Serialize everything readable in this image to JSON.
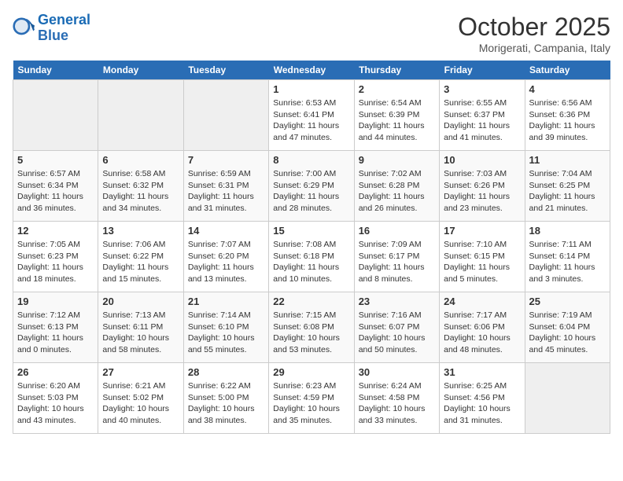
{
  "logo": {
    "line1": "General",
    "line2": "Blue"
  },
  "title": "October 2025",
  "location": "Morigerati, Campania, Italy",
  "weekdays": [
    "Sunday",
    "Monday",
    "Tuesday",
    "Wednesday",
    "Thursday",
    "Friday",
    "Saturday"
  ],
  "weeks": [
    [
      {
        "day": "",
        "empty": true
      },
      {
        "day": "",
        "empty": true
      },
      {
        "day": "",
        "empty": true
      },
      {
        "day": "1",
        "sunrise": "6:53 AM",
        "sunset": "6:41 PM",
        "daylight": "11 hours and 47 minutes."
      },
      {
        "day": "2",
        "sunrise": "6:54 AM",
        "sunset": "6:39 PM",
        "daylight": "11 hours and 44 minutes."
      },
      {
        "day": "3",
        "sunrise": "6:55 AM",
        "sunset": "6:37 PM",
        "daylight": "11 hours and 41 minutes."
      },
      {
        "day": "4",
        "sunrise": "6:56 AM",
        "sunset": "6:36 PM",
        "daylight": "11 hours and 39 minutes."
      }
    ],
    [
      {
        "day": "5",
        "sunrise": "6:57 AM",
        "sunset": "6:34 PM",
        "daylight": "11 hours and 36 minutes."
      },
      {
        "day": "6",
        "sunrise": "6:58 AM",
        "sunset": "6:32 PM",
        "daylight": "11 hours and 34 minutes."
      },
      {
        "day": "7",
        "sunrise": "6:59 AM",
        "sunset": "6:31 PM",
        "daylight": "11 hours and 31 minutes."
      },
      {
        "day": "8",
        "sunrise": "7:00 AM",
        "sunset": "6:29 PM",
        "daylight": "11 hours and 28 minutes."
      },
      {
        "day": "9",
        "sunrise": "7:02 AM",
        "sunset": "6:28 PM",
        "daylight": "11 hours and 26 minutes."
      },
      {
        "day": "10",
        "sunrise": "7:03 AM",
        "sunset": "6:26 PM",
        "daylight": "11 hours and 23 minutes."
      },
      {
        "day": "11",
        "sunrise": "7:04 AM",
        "sunset": "6:25 PM",
        "daylight": "11 hours and 21 minutes."
      }
    ],
    [
      {
        "day": "12",
        "sunrise": "7:05 AM",
        "sunset": "6:23 PM",
        "daylight": "11 hours and 18 minutes."
      },
      {
        "day": "13",
        "sunrise": "7:06 AM",
        "sunset": "6:22 PM",
        "daylight": "11 hours and 15 minutes."
      },
      {
        "day": "14",
        "sunrise": "7:07 AM",
        "sunset": "6:20 PM",
        "daylight": "11 hours and 13 minutes."
      },
      {
        "day": "15",
        "sunrise": "7:08 AM",
        "sunset": "6:18 PM",
        "daylight": "11 hours and 10 minutes."
      },
      {
        "day": "16",
        "sunrise": "7:09 AM",
        "sunset": "6:17 PM",
        "daylight": "11 hours and 8 minutes."
      },
      {
        "day": "17",
        "sunrise": "7:10 AM",
        "sunset": "6:15 PM",
        "daylight": "11 hours and 5 minutes."
      },
      {
        "day": "18",
        "sunrise": "7:11 AM",
        "sunset": "6:14 PM",
        "daylight": "11 hours and 3 minutes."
      }
    ],
    [
      {
        "day": "19",
        "sunrise": "7:12 AM",
        "sunset": "6:13 PM",
        "daylight": "11 hours and 0 minutes."
      },
      {
        "day": "20",
        "sunrise": "7:13 AM",
        "sunset": "6:11 PM",
        "daylight": "10 hours and 58 minutes."
      },
      {
        "day": "21",
        "sunrise": "7:14 AM",
        "sunset": "6:10 PM",
        "daylight": "10 hours and 55 minutes."
      },
      {
        "day": "22",
        "sunrise": "7:15 AM",
        "sunset": "6:08 PM",
        "daylight": "10 hours and 53 minutes."
      },
      {
        "day": "23",
        "sunrise": "7:16 AM",
        "sunset": "6:07 PM",
        "daylight": "10 hours and 50 minutes."
      },
      {
        "day": "24",
        "sunrise": "7:17 AM",
        "sunset": "6:06 PM",
        "daylight": "10 hours and 48 minutes."
      },
      {
        "day": "25",
        "sunrise": "7:19 AM",
        "sunset": "6:04 PM",
        "daylight": "10 hours and 45 minutes."
      }
    ],
    [
      {
        "day": "26",
        "sunrise": "6:20 AM",
        "sunset": "5:03 PM",
        "daylight": "10 hours and 43 minutes."
      },
      {
        "day": "27",
        "sunrise": "6:21 AM",
        "sunset": "5:02 PM",
        "daylight": "10 hours and 40 minutes."
      },
      {
        "day": "28",
        "sunrise": "6:22 AM",
        "sunset": "5:00 PM",
        "daylight": "10 hours and 38 minutes."
      },
      {
        "day": "29",
        "sunrise": "6:23 AM",
        "sunset": "4:59 PM",
        "daylight": "10 hours and 35 minutes."
      },
      {
        "day": "30",
        "sunrise": "6:24 AM",
        "sunset": "4:58 PM",
        "daylight": "10 hours and 33 minutes."
      },
      {
        "day": "31",
        "sunrise": "6:25 AM",
        "sunset": "4:56 PM",
        "daylight": "10 hours and 31 minutes."
      },
      {
        "day": "",
        "empty": true
      }
    ]
  ]
}
